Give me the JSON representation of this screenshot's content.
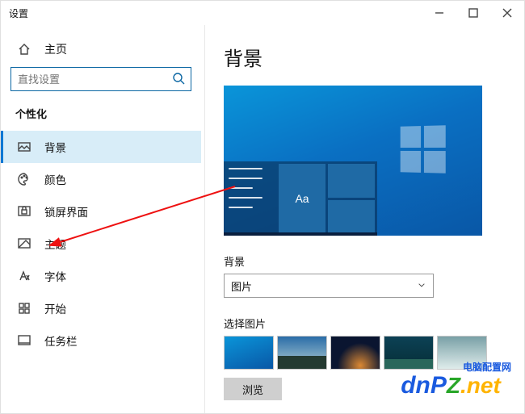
{
  "window": {
    "title": "设置"
  },
  "sidebar": {
    "home_label": "主页",
    "search_placeholder": "直找设置",
    "section_title": "个性化",
    "items": [
      {
        "label": "背景"
      },
      {
        "label": "颜色"
      },
      {
        "label": "锁屏界面"
      },
      {
        "label": "主题"
      },
      {
        "label": "字体"
      },
      {
        "label": "开始"
      },
      {
        "label": "任务栏"
      }
    ]
  },
  "content": {
    "heading": "背景",
    "preview_text": "Aa",
    "background_label": "背景",
    "background_select_value": "图片",
    "choose_label": "选择图片",
    "browse_label": "浏览"
  },
  "watermark": {
    "brand1": "dnP",
    "brand2": "Z",
    "suffix": ".net",
    "cn": "电脑配置网"
  }
}
